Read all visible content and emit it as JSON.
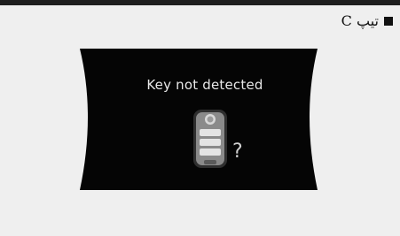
{
  "header": {
    "type_label": "تیپ C"
  },
  "display": {
    "message": "Key not detected",
    "question_mark": "?",
    "icon": "smart-key-icon"
  }
}
